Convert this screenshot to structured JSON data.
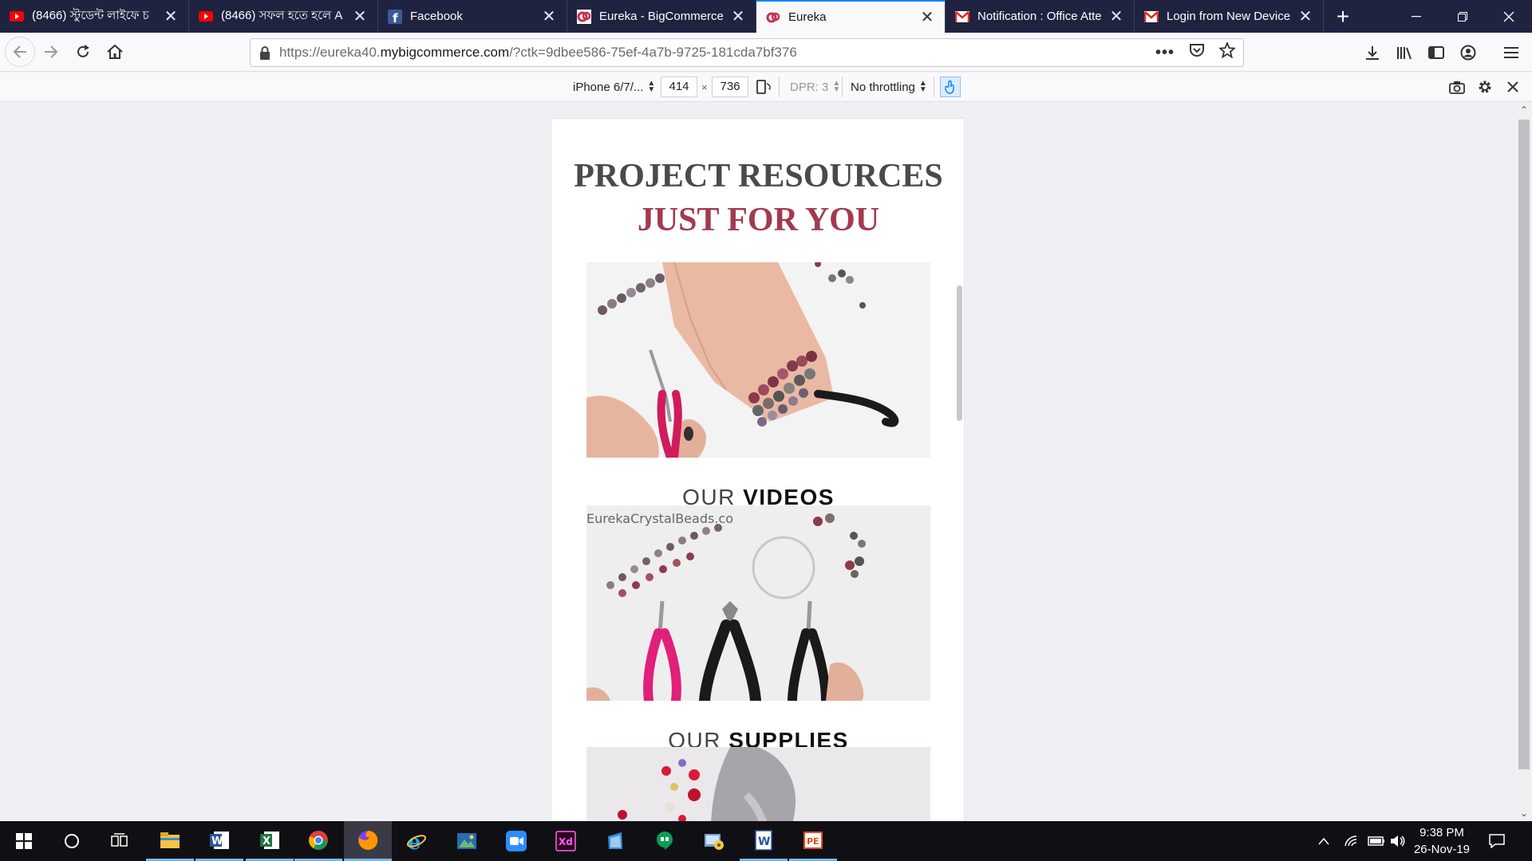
{
  "browser": {
    "tabs": [
      {
        "title": "(8466) স্টুডেন্ট লাইফে চ",
        "icon": "youtube-icon",
        "active": false
      },
      {
        "title": "(8466) সফল হতে হলে A",
        "icon": "youtube-icon",
        "active": false
      },
      {
        "title": "Facebook",
        "icon": "facebook-icon",
        "active": false
      },
      {
        "title": "Eureka - BigCommerce",
        "icon": "eureka-icon",
        "active": false
      },
      {
        "title": "Eureka",
        "icon": "eureka-icon",
        "active": true
      },
      {
        "title": "Notification : Office Atte",
        "icon": "gmail-icon",
        "active": false
      },
      {
        "title": "Login from New Device",
        "icon": "gmail-icon",
        "active": false
      }
    ],
    "url_prefix": "https://eureka40.",
    "url_domain": "mybigcommerce.com",
    "url_suffix": "/?ctk=9dbee586-75ef-4a7b-9725-181cda7bf376"
  },
  "responsive_toolbar": {
    "device": "iPhone 6/7/...",
    "width": "414",
    "times": "×",
    "height": "736",
    "dpr": "DPR: 3",
    "throttling": "No throttling"
  },
  "page": {
    "heading_line1": "PROJECT RESOURCES",
    "heading_line2": "JUST FOR YOU",
    "sections": [
      {
        "light": "OUR",
        "strong": "VIDEOS"
      },
      {
        "light": "OUR",
        "strong": "SUPPLIES"
      }
    ],
    "watermark": "EurekaCrystalBeads.co",
    "accent_color": "#a23a4f"
  },
  "taskbar": {
    "time": "9:38 PM",
    "date": "26-Nov-19"
  }
}
